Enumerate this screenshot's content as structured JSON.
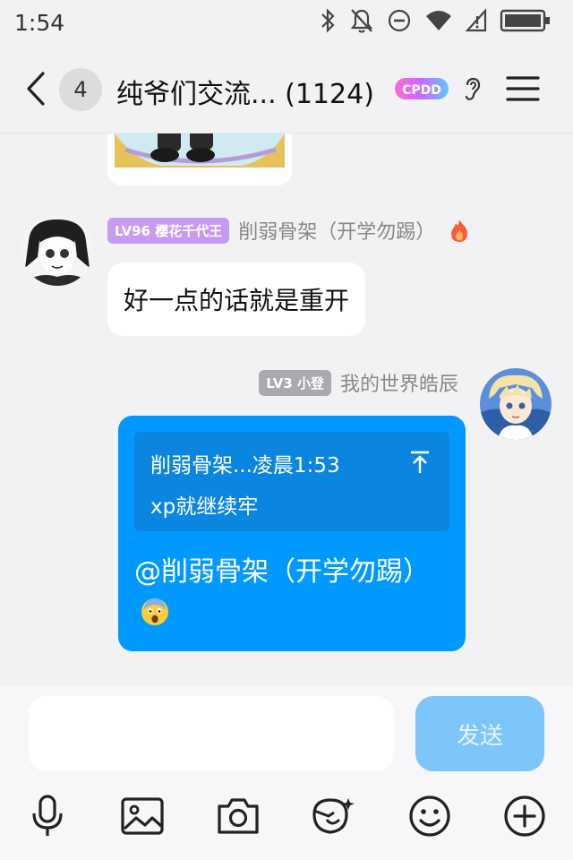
{
  "status_bar": {
    "time": "1:54",
    "icons": [
      "bluetooth-icon",
      "mute-icon",
      "do-not-disturb-icon",
      "wifi-icon",
      "signal-icon",
      "battery-icon"
    ]
  },
  "header": {
    "unread_count": "4",
    "title": "纯爷们交流... (1124)",
    "badge_text": "CPDD",
    "icons": [
      "back-icon",
      "ear-icon",
      "menu-icon"
    ]
  },
  "messages": [
    {
      "type": "image",
      "side": "left"
    },
    {
      "side": "left",
      "level": "LV96 樱花千代王",
      "level_color": "#c69bf2",
      "sender": "削弱骨架（开学勿踢）",
      "text": "好一点的话就是重开"
    },
    {
      "side": "right",
      "level": "LV3 小登",
      "level_color": "#a9a9ae",
      "sender": "我的世界皓辰",
      "quote": {
        "header": "削弱骨架...凌晨1:53",
        "text": "xp就继续牢"
      },
      "text": "@削弱骨架（开学勿踢）"
    }
  ],
  "input": {
    "value": "",
    "send_label": "发送"
  },
  "toolbar": [
    "microphone-icon",
    "image-icon",
    "camera-icon",
    "sticker-icon",
    "emoji-icon",
    "plus-icon"
  ],
  "colors": {
    "accent": "#0099ff",
    "send_disabled": "#7cc6fb",
    "background": "#f2f2f5"
  }
}
